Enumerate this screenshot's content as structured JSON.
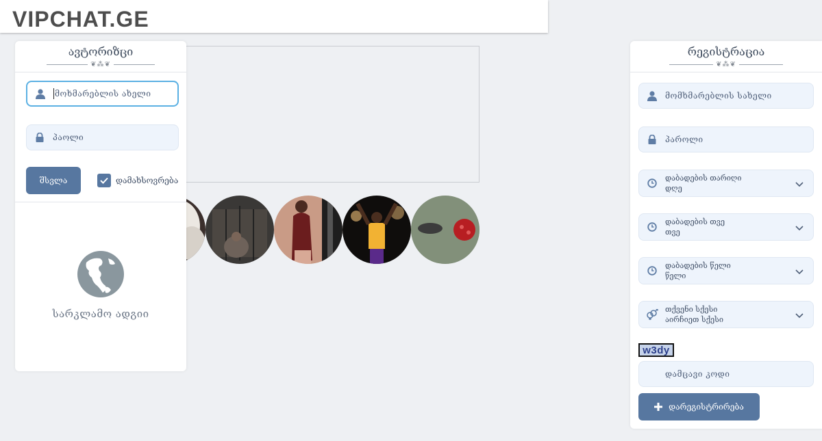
{
  "site": {
    "logo": "VIPCHAT.GE"
  },
  "login": {
    "title": "ავტორიზცი",
    "username_placeholder": "მოხმარებლის ახელი",
    "password_placeholder": "პაოლი",
    "submit_label": "შსვლა",
    "remember_label": "დამახსოვრება",
    "ad_label": "სარკლამო ადგიი"
  },
  "register": {
    "title": "რეგისტრაცია",
    "username_placeholder": "მომხმარებლის სახელი",
    "password_placeholder": "პაროლი",
    "birth_day": {
      "label": "დაბადების თარიღი",
      "value": "დღე"
    },
    "birth_month": {
      "label": "დაბადების თვე",
      "value": "თვე"
    },
    "birth_year": {
      "label": "დაბადების წელი",
      "value": "წელი"
    },
    "gender": {
      "label": "თქვენი სქესი",
      "value": "აირჩიეთ სქესი"
    },
    "captcha_text": "w3dy",
    "captcha_placeholder": "დამცავი კოდი",
    "submit_label": "დარეგისტრირება"
  },
  "icons": {
    "user": "user-icon",
    "lock": "lock-icon",
    "clock": "clock-icon",
    "gender": "gender-icon",
    "chevron": "chevron-down-icon",
    "check": "check-icon",
    "plus": "plus-icon",
    "globe": "globe-icon"
  },
  "colors": {
    "accent": "#5777a0",
    "focus_border": "#5ab0e3",
    "field_bg": "#eef4fc"
  }
}
